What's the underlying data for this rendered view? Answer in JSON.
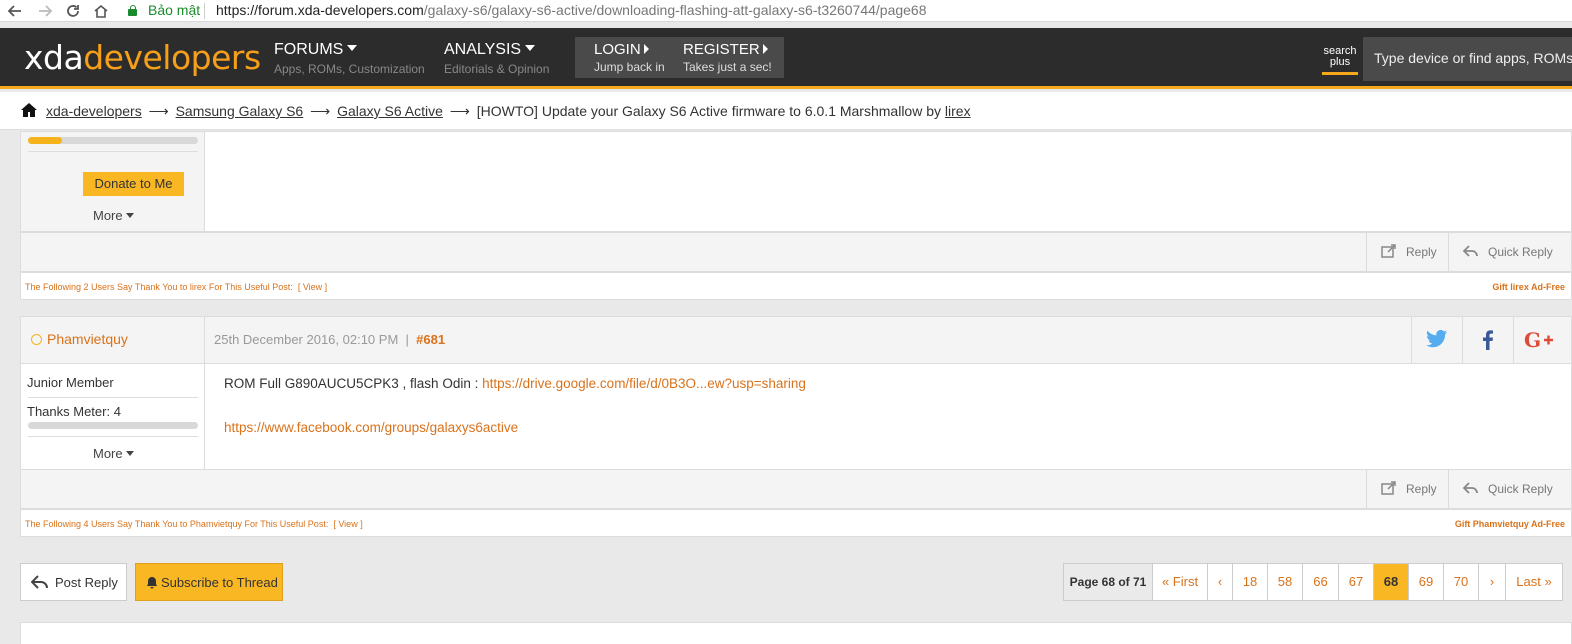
{
  "browser": {
    "secure_label": "Bảo mật",
    "url_domain": "https://forum.xda-developers.com",
    "url_path": "/galaxy-s6/galaxy-s6-active/downloading-flashing-att-galaxy-s6-t3260744/page68"
  },
  "header": {
    "logo_a": "xda",
    "logo_b": "developers",
    "forums": {
      "title": "FORUMS",
      "sub": "Apps, ROMs, Customization"
    },
    "analysis": {
      "title": "ANALYSIS",
      "sub": "Editorials & Opinion"
    },
    "login": {
      "title": "LOGIN",
      "sub": "Jump back in"
    },
    "register": {
      "title": "REGISTER",
      "sub": "Takes just a sec!"
    },
    "search_plus_1": "search",
    "search_plus_2": "plus",
    "search_placeholder": "Type device or find apps, ROMs, &"
  },
  "breadcrumb": {
    "items": [
      "xda-developers",
      "Samsung Galaxy S6",
      "Galaxy S6 Active"
    ],
    "arrow": "⟶",
    "title_prefix": "[HOWTO] Update your Galaxy S6 Active firmware to 6.0.1 Marshmallow by",
    "author": "lirex"
  },
  "post1": {
    "thanks_meter_fraction": 0.2,
    "donate_label": "Donate to Me",
    "more_label": "More",
    "reply_label": "Reply",
    "quick_reply_label": "Quick Reply",
    "thanks_text": "The Following 2 Users Say Thank You to lirex For This Useful Post:",
    "view_label": "[ View ]",
    "gift_label": "Gift lirex Ad-Free"
  },
  "post2": {
    "username": "Phamvietquy",
    "date": "25th December 2016, 02:10 PM",
    "separator": "|",
    "number": "#681",
    "rank": "Junior Member",
    "thanks_meter_label": "Thanks Meter: 4",
    "thanks_meter_fraction": 0.0,
    "more_label": "More",
    "line1_text": "ROM Full G890AUCU5CPK3 , flash Odin :",
    "line1_link": "https://drive.google.com/file/d/0B3O...ew?usp=sharing",
    "line2_link": "https://www.facebook.com/groups/galaxys6active",
    "reply_label": "Reply",
    "quick_reply_label": "Quick Reply",
    "thanks_text": "The Following 4 Users Say Thank You to Phamvietquy For This Useful Post:",
    "view_label": "[ View ]",
    "gift_label": "Gift Phamvietquy Ad-Free"
  },
  "footer": {
    "post_reply": "Post Reply",
    "subscribe": "Subscribe to Thread",
    "page_info": "Page 68 of 71",
    "first": "« First",
    "prev": "‹",
    "pages": [
      "18",
      "58",
      "66",
      "67",
      "68",
      "69",
      "70"
    ],
    "current_page": "68",
    "next": "›",
    "last": "Last »"
  },
  "colors": {
    "accent": "#f5a81b",
    "link": "#d9721b",
    "header_bg": "#2c2c2c",
    "twitter": "#55acee",
    "facebook": "#3b5998",
    "gplus": "#dd4b39"
  }
}
